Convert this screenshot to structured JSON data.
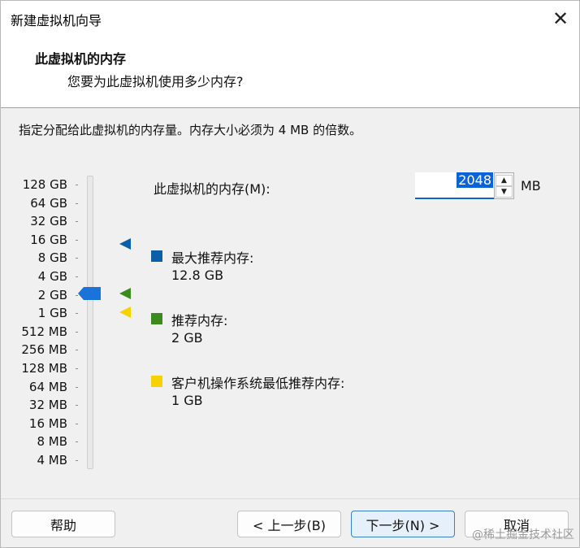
{
  "window": {
    "title": "新建虚拟机向导",
    "close_symbol": "✕"
  },
  "header": {
    "title": "此虚拟机的内存",
    "subtitle": "您要为此虚拟机使用多少内存?"
  },
  "instruction": "指定分配给此虚拟机的内存量。内存大小必须为 4 MB 的倍数。",
  "scale_labels": [
    "128 GB",
    "64 GB",
    "32 GB",
    "16 GB",
    "8 GB",
    "4 GB",
    "2 GB",
    "1 GB",
    "512 MB",
    "256 MB",
    "128 MB",
    "64 MB",
    "32 MB",
    "16 MB",
    "8 MB",
    "4 MB"
  ],
  "memory": {
    "label": "此虚拟机的内存(M):",
    "value": "2048",
    "unit": "MB",
    "slider_value": "2 GB"
  },
  "legend": {
    "max": {
      "label": "最大推荐内存:",
      "value": "12.8 GB",
      "color": "#0a5fa8"
    },
    "recommended": {
      "label": "推荐内存:",
      "value": "2 GB",
      "color": "#3a8a1e"
    },
    "minimum": {
      "label": "客户机操作系统最低推荐内存:",
      "value": "1 GB",
      "color": "#f6d200"
    }
  },
  "buttons": {
    "help": "帮助",
    "back": "< 上一步(B)",
    "next": "下一步(N) >",
    "cancel": "取消"
  },
  "watermark": "@稀土掘金技术社区"
}
